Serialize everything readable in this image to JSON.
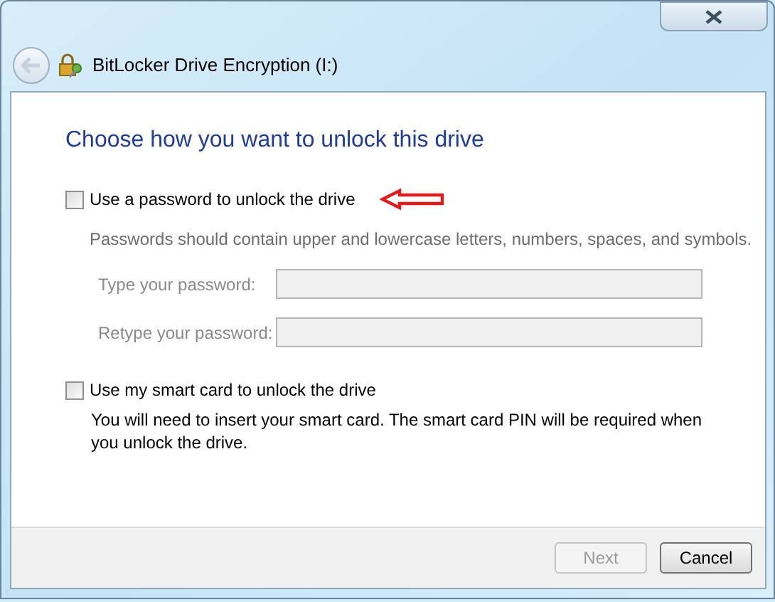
{
  "window": {
    "title": "BitLocker Drive Encryption (I:)"
  },
  "heading": "Choose how you want to unlock this drive",
  "options": [
    {
      "kind": "password",
      "label": "Use a password to unlock the drive",
      "checked": false,
      "hint": "Passwords should contain upper and lowercase letters, numbers, spaces, and symbols.",
      "fields": [
        {
          "label": "Type your password:",
          "disabled": true
        },
        {
          "label": "Retype your password:",
          "disabled": true
        }
      ]
    },
    {
      "kind": "smartcard",
      "label": "Use my smart card to unlock the drive",
      "checked": false,
      "description": "You will need to insert your smart card. The smart card PIN will be required when you unlock the drive."
    }
  ],
  "buttons": [
    {
      "label": "Next",
      "disabled": true
    },
    {
      "label": "Cancel",
      "disabled": false
    }
  ]
}
